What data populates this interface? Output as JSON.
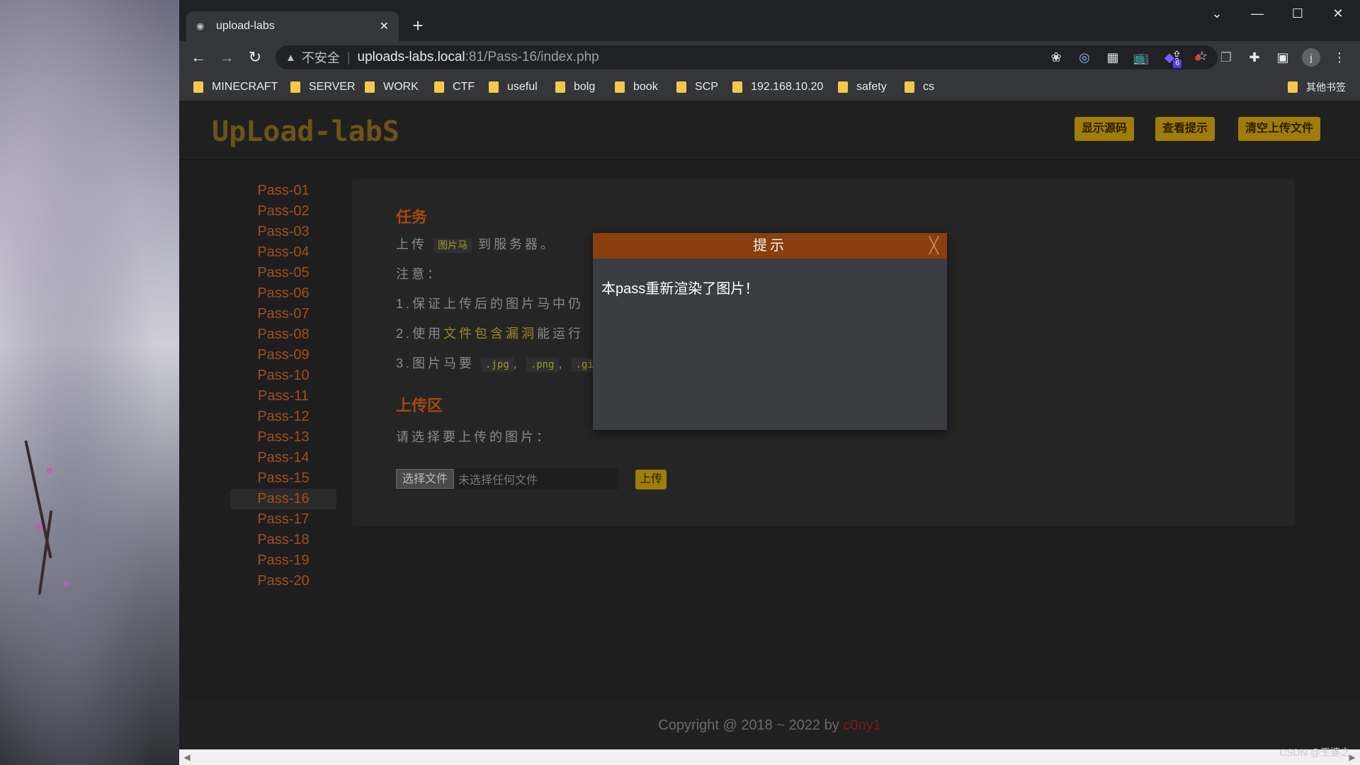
{
  "browser": {
    "tab_title": "upload-labs",
    "tab_close": "✕",
    "new_tab": "+",
    "omnibox": {
      "security": "不安全",
      "host": "uploads-labs.local",
      "path": ":81/Pass-16/index.php"
    },
    "window_controls": [
      "⌄",
      "—",
      "☐",
      "✕"
    ],
    "profile_initial": "j",
    "extension_badge": "6"
  },
  "bookmarks": {
    "items": [
      "MINECRAFT",
      "SERVER",
      "WORK",
      "CTF",
      "useful",
      "bolg",
      "book",
      "SCP",
      "192.168.10.20",
      "safety",
      "cs"
    ],
    "other": "其他书签"
  },
  "header": {
    "logo_text": "UpLoad-labS",
    "buttons": {
      "show_source": "显示源码",
      "view_hint": "查看提示",
      "clear_uploads": "清空上传文件"
    }
  },
  "sidebar": {
    "items": [
      "Pass-01",
      "Pass-02",
      "Pass-03",
      "Pass-04",
      "Pass-05",
      "Pass-06",
      "Pass-07",
      "Pass-08",
      "Pass-09",
      "Pass-10",
      "Pass-11",
      "Pass-12",
      "Pass-13",
      "Pass-14",
      "Pass-15",
      "Pass-16",
      "Pass-17",
      "Pass-18",
      "Pass-19",
      "Pass-20"
    ],
    "active": "Pass-16"
  },
  "task": {
    "heading": "任务",
    "line1_prefix": "上传",
    "line1_code": "图片马",
    "line1_suffix": "到服务器。",
    "note_label": "注意：",
    "note1": "1.保证上传后的图片马中仍",
    "note2_prefix": "2.使用",
    "note2_hl": "文件包含漏洞",
    "note2_suffix": "能运行",
    "note3_prefix": "3.图片马要",
    "note3_jpg": ".jpg",
    "note3_comma1": ",",
    "note3_png": ".png",
    "note3_comma2": ",",
    "note3_gif": ".gif"
  },
  "upload": {
    "heading": "上传区",
    "prompt": "请选择要上传的图片：",
    "choose_file": "选择文件",
    "no_file": "未选择任何文件",
    "submit": "上传"
  },
  "modal": {
    "title": "提示",
    "close": "╳",
    "message": "本pass重新渲染了图片！"
  },
  "footer": {
    "text": "Copyright @ 2018 ~ 2022 by ",
    "author": "c0ny1"
  },
  "watermark": "CSDN @王婆之"
}
